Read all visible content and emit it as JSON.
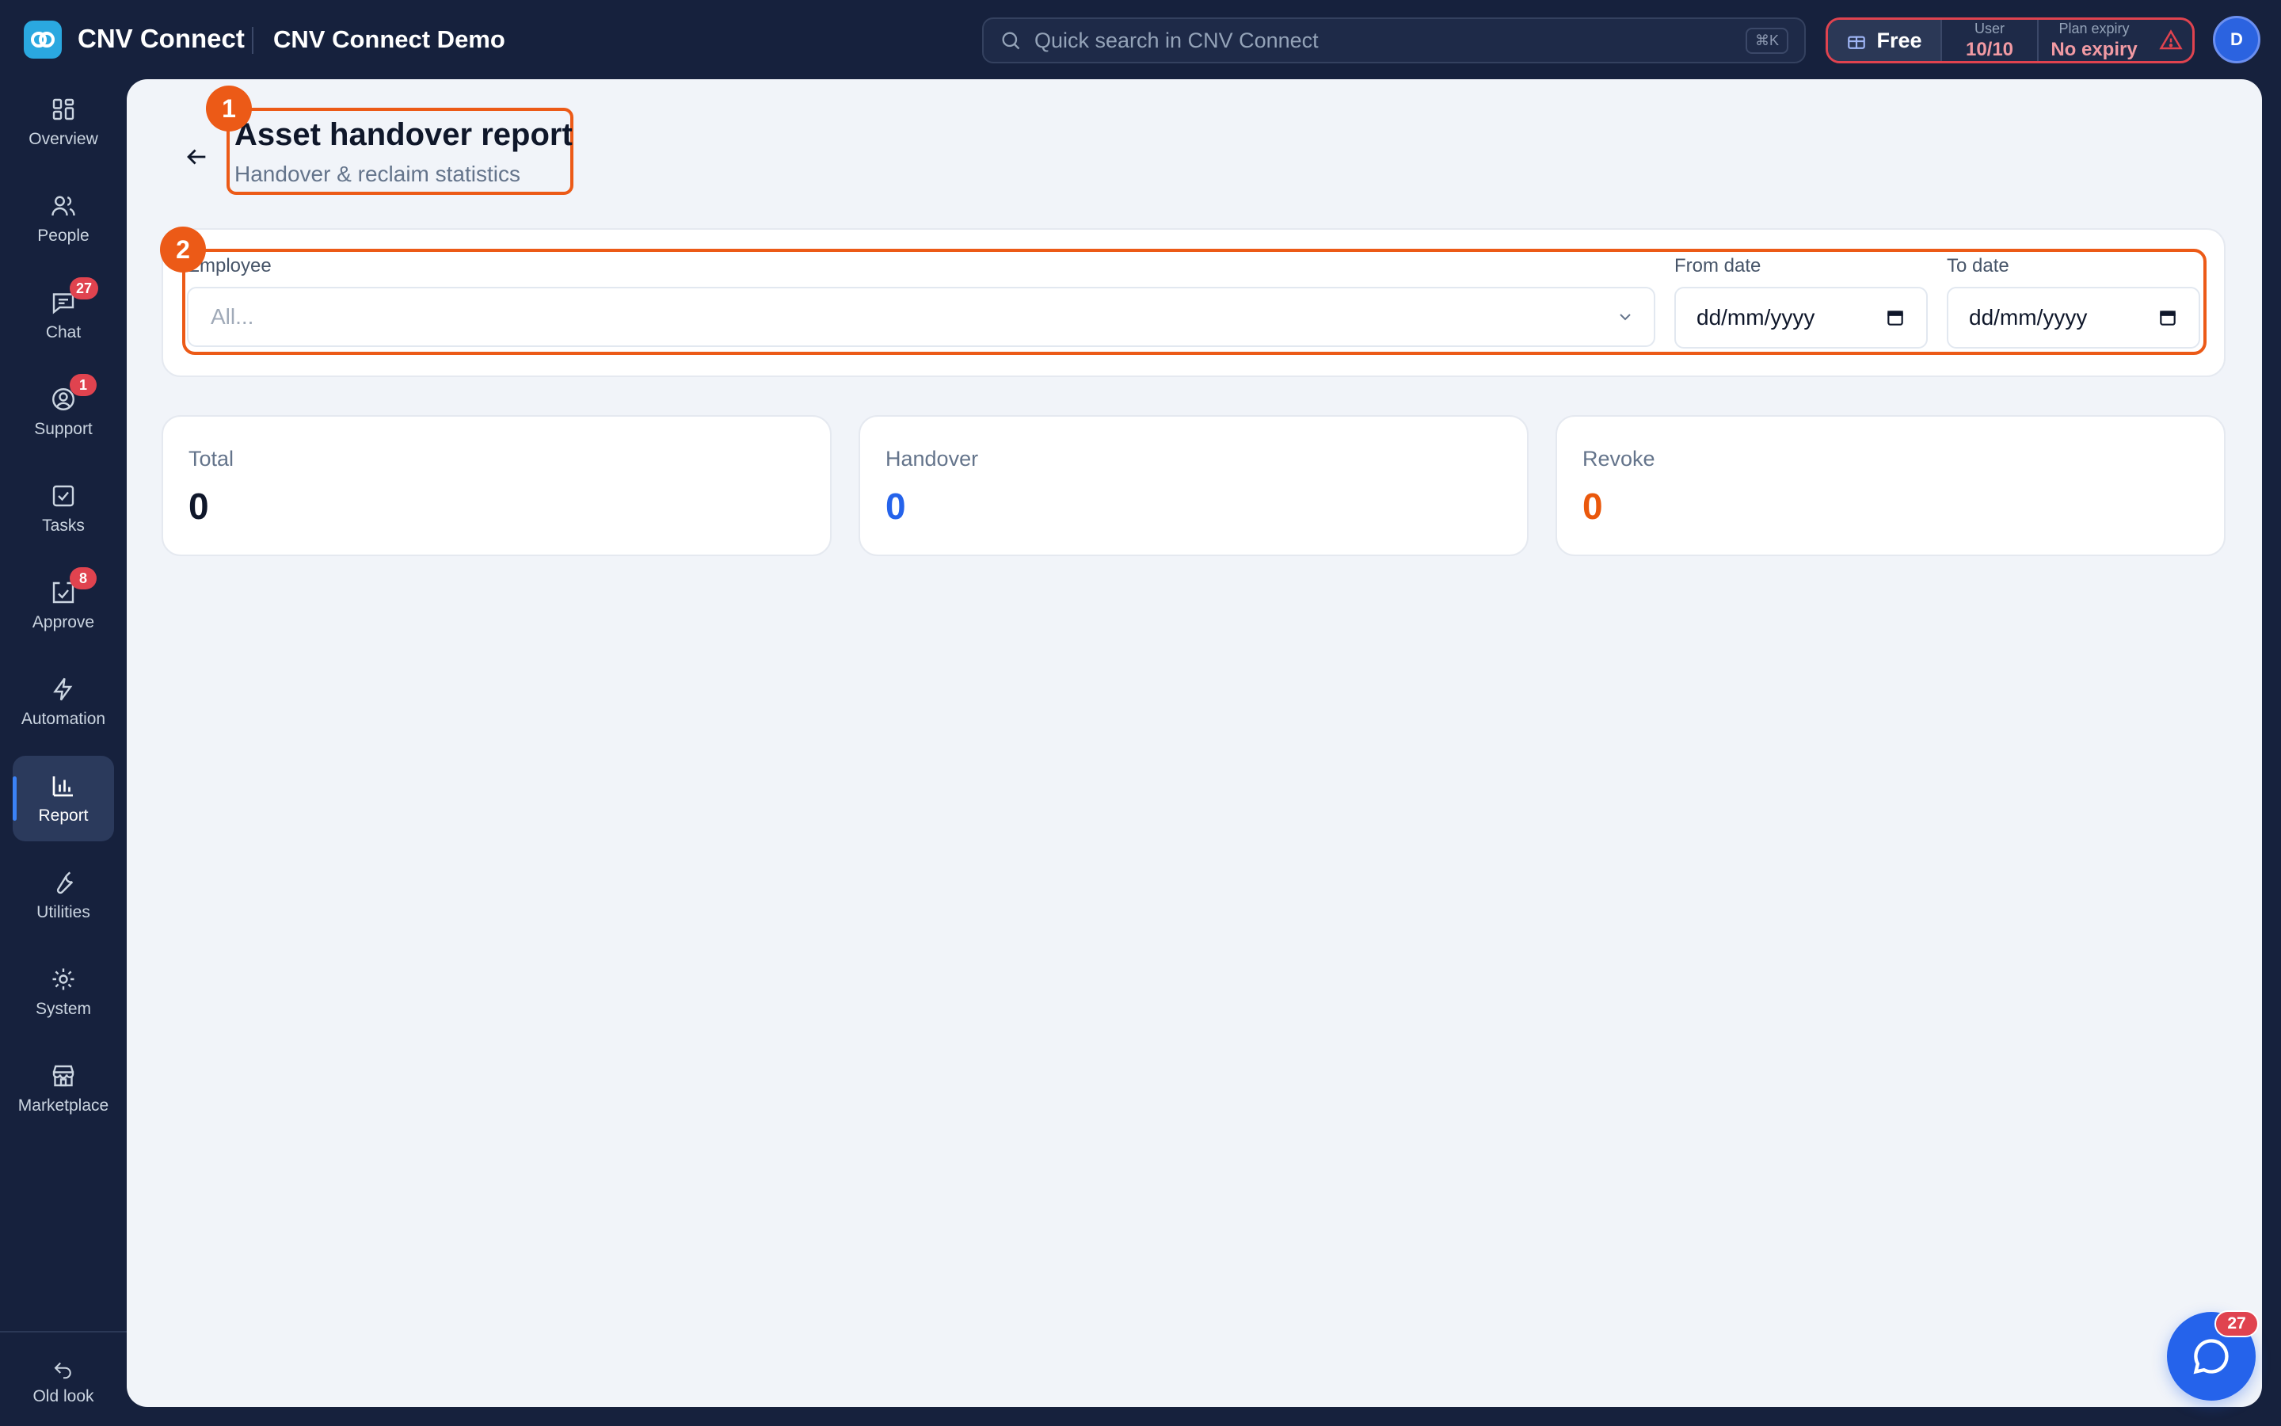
{
  "app": {
    "brand": "CNV Connect",
    "org_name": "CNV Connect Demo"
  },
  "search": {
    "placeholder": "Quick search in CNV Connect",
    "shortcut": "⌘K"
  },
  "plan": {
    "tier": "Free",
    "user_caption": "User",
    "user_value": "10/10",
    "expiry_caption": "Plan expiry",
    "expiry_value": "No expiry"
  },
  "user": {
    "avatar_initial": "D"
  },
  "sidebar": {
    "items": [
      {
        "label": "Overview",
        "icon": "grid-icon"
      },
      {
        "label": "People",
        "icon": "people-icon"
      },
      {
        "label": "Chat",
        "icon": "chat-icon",
        "badge": "27"
      },
      {
        "label": "Support",
        "icon": "support-icon",
        "badge": "1"
      },
      {
        "label": "Tasks",
        "icon": "tasks-icon"
      },
      {
        "label": "Approve",
        "icon": "approve-icon",
        "badge": "8"
      },
      {
        "label": "Automation",
        "icon": "bolt-icon"
      },
      {
        "label": "Report",
        "icon": "bar-chart-icon",
        "active": true
      },
      {
        "label": "Utilities",
        "icon": "wrench-icon"
      },
      {
        "label": "System",
        "icon": "gear-icon"
      },
      {
        "label": "Marketplace",
        "icon": "store-icon"
      }
    ],
    "old_look": "Old look"
  },
  "page": {
    "title": "Asset handover report",
    "subtitle": "Handover & reclaim statistics"
  },
  "markers": [
    "1",
    "2"
  ],
  "filters": {
    "employee_label": "Employee",
    "employee_placeholder": "All...",
    "from_label": "From date",
    "from_value": "dd/mm/yyyy",
    "to_label": "To date",
    "to_value": "dd/mm/yyyy"
  },
  "stats": [
    {
      "label": "Total",
      "value": "0",
      "color": "#0f172a"
    },
    {
      "label": "Handover",
      "value": "0",
      "color": "#2563eb"
    },
    {
      "label": "Revoke",
      "value": "0",
      "color": "#ea580c"
    }
  ],
  "chat_fab": {
    "badge": "27"
  },
  "colors": {
    "sidebar_bg": "#16213d",
    "accent": "#2563eb",
    "highlight": "#ec5a17",
    "alert": "#e0434f"
  }
}
